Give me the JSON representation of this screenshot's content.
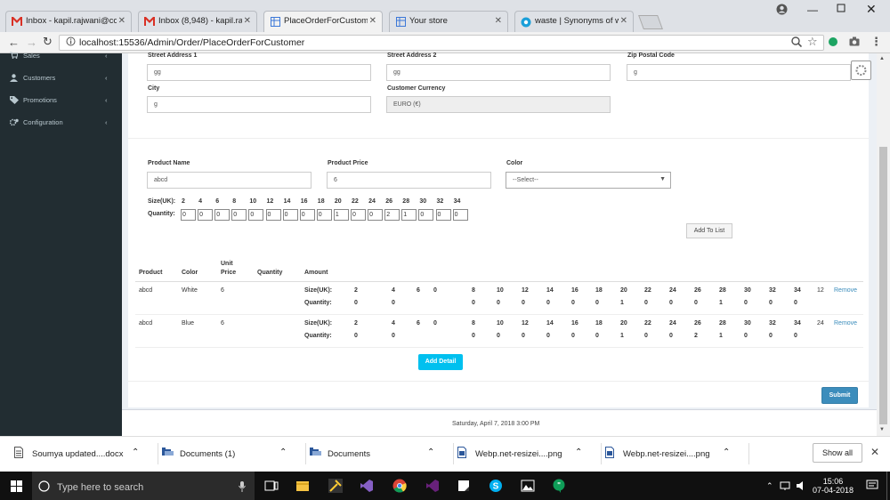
{
  "browser": {
    "tabs": [
      {
        "label": "Inbox - kapil.rajwani@co",
        "icon": "gmail-icon"
      },
      {
        "label": "Inbox (8,948) - kapil.rajw",
        "icon": "gmail-icon"
      },
      {
        "label": "PlaceOrderForCustomer",
        "icon": "page-grid-icon"
      },
      {
        "label": "Your store",
        "icon": "page-grid-icon"
      },
      {
        "label": "waste | Synonyms of was",
        "icon": "synonym-icon"
      }
    ],
    "url": "localhost:15536/Admin/Order/PlaceOrderForCustomer"
  },
  "sidebar": {
    "items": [
      {
        "label": "Sales",
        "icon": "cart-icon"
      },
      {
        "label": "Customers",
        "icon": "user-icon"
      },
      {
        "label": "Promotions",
        "icon": "tag-icon"
      },
      {
        "label": "Configuration",
        "icon": "gears-icon"
      }
    ]
  },
  "address": {
    "street1_label": "Street Address 1",
    "street1_value": "gg",
    "street2_label": "Street Address 2",
    "street2_value": "gg",
    "zip_label": "Zip Postal Code",
    "zip_value": "g",
    "city_label": "City",
    "city_value": "g",
    "currency_label": "Customer Currency",
    "currency_value": "EURO (€)"
  },
  "product_form": {
    "name_label": "Product Name",
    "name_value": "abcd",
    "price_label": "Product Price",
    "price_value": "6",
    "color_label": "Color",
    "color_value": "--Select--",
    "size_label": "Size(UK):",
    "qty_label": "Quantity:",
    "sizes": [
      "2",
      "4",
      "6",
      "8",
      "10",
      "12",
      "14",
      "16",
      "18",
      "20",
      "22",
      "24",
      "26",
      "28",
      "30",
      "32",
      "34"
    ],
    "quantities": [
      "0",
      "0",
      "0",
      "0",
      "0",
      "0",
      "0",
      "0",
      "0",
      "1",
      "0",
      "0",
      "2",
      "1",
      "0",
      "0",
      "0"
    ],
    "add_to_list": "Add To List"
  },
  "order_table": {
    "headers": {
      "product": "Product",
      "color": "Color",
      "unit_price": "Unit Price",
      "quantity": "Quantity",
      "amount": "Amount"
    },
    "rows": [
      {
        "product": "abcd",
        "color": "White",
        "unit_price": "6",
        "size_label": "Size(UK):",
        "qty_label": "Quantity:",
        "sizes": [
          "2",
          "4",
          "6",
          "0",
          "8",
          "10",
          "12",
          "14",
          "16",
          "18",
          "20",
          "22",
          "24",
          "26",
          "28",
          "30",
          "32",
          "34"
        ],
        "quantities": [
          "0",
          "0",
          "",
          "",
          "0",
          "0",
          "0",
          "0",
          "0",
          "0",
          "1",
          "0",
          "0",
          "0",
          "1",
          "0",
          "0",
          "0"
        ],
        "amount": "12",
        "remove": "Remove"
      },
      {
        "product": "abcd",
        "color": "Blue",
        "unit_price": "6",
        "size_label": "Size(UK):",
        "qty_label": "Quantity:",
        "sizes": [
          "2",
          "4",
          "6",
          "0",
          "8",
          "10",
          "12",
          "14",
          "16",
          "18",
          "20",
          "22",
          "24",
          "26",
          "28",
          "30",
          "32",
          "34"
        ],
        "quantities": [
          "0",
          "0",
          "",
          "",
          "0",
          "0",
          "0",
          "0",
          "0",
          "0",
          "1",
          "0",
          "0",
          "2",
          "1",
          "0",
          "0",
          "0"
        ],
        "amount": "24",
        "remove": "Remove"
      }
    ],
    "add_detail": "Add Detail"
  },
  "submit": "Submit",
  "footer_date": "Saturday, April 7, 2018 3:00 PM",
  "downloads": [
    {
      "name": "Soumya updated....docx",
      "icon": "document-icon"
    },
    {
      "name": "Documents (1)",
      "icon": "folder-icon"
    },
    {
      "name": "Documents",
      "icon": "folder-icon"
    },
    {
      "name": "Webp.net-resizei....png",
      "icon": "image-file-icon"
    },
    {
      "name": "Webp.net-resizei....png",
      "icon": "image-file-icon"
    }
  ],
  "show_all": "Show all",
  "taskbar": {
    "search_placeholder": "Type here to search",
    "time": "15:06",
    "date": "07-04-2018"
  },
  "colors": {
    "sidebar": "#222d32",
    "accent": "#00c0ef",
    "primary": "#3c8dbc",
    "link": "#3c8dbc"
  }
}
